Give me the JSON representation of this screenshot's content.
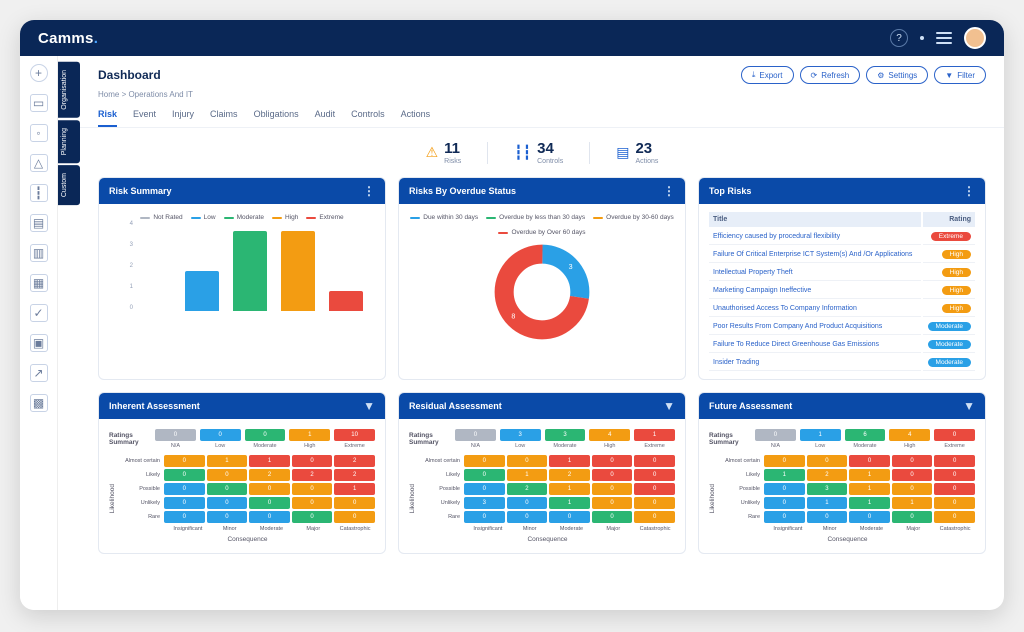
{
  "brand": "Camms",
  "header": {
    "title": "Dashboard",
    "breadcrumb": "Home > Operations And IT",
    "buttons": {
      "export": "Export",
      "refresh": "Refresh",
      "settings": "Settings",
      "filter": "Filter"
    }
  },
  "sideTabs": [
    "Organisation",
    "Planning",
    "Custom"
  ],
  "tabs": [
    "Risk",
    "Event",
    "Injury",
    "Claims",
    "Obligations",
    "Audit",
    "Controls",
    "Actions"
  ],
  "activeTab": 0,
  "kpis": [
    {
      "value": "11",
      "label": "Risks",
      "color": "#f39c12"
    },
    {
      "value": "34",
      "label": "Controls",
      "color": "#1a5fd0"
    },
    {
      "value": "23",
      "label": "Actions",
      "color": "#1a5fd0"
    }
  ],
  "colors": {
    "notRated": "#b0b7c3",
    "low": "#2aa0e6",
    "moderate": "#2bb673",
    "high": "#f39c12",
    "extreme": "#ea4a3e"
  },
  "riskSummary": {
    "title": "Risk Summary",
    "legend": [
      "Not Rated",
      "Low",
      "Moderate",
      "High",
      "Extreme"
    ]
  },
  "chart_data": [
    {
      "type": "bar",
      "id": "risk-summary",
      "categories": [
        "Not Rated",
        "Low",
        "Moderate",
        "High",
        "Extreme"
      ],
      "values": [
        0,
        2,
        4,
        4,
        1
      ],
      "colors": [
        "#b0b7c3",
        "#2aa0e6",
        "#2bb673",
        "#f39c12",
        "#ea4a3e"
      ],
      "ylim": [
        0,
        4
      ]
    },
    {
      "type": "pie",
      "id": "overdue-status",
      "series": [
        {
          "name": "Due within 30 days",
          "value": 3,
          "color": "#2aa0e6"
        },
        {
          "name": "Overdue by less than 30 days",
          "value": 0,
          "color": "#2bb673"
        },
        {
          "name": "Overdue by 30-60 days",
          "value": 0,
          "color": "#f39c12"
        },
        {
          "name": "Overdue by Over 60 days",
          "value": 8,
          "color": "#ea4a3e"
        }
      ]
    }
  ],
  "overdueCard": {
    "title": "Risks By Overdue Status",
    "legend": [
      "Due within 30 days",
      "Overdue by less than 30 days",
      "Overdue by 30-60 days",
      "Overdue by Over 60 days"
    ]
  },
  "topRisks": {
    "title": "Top Risks",
    "columns": [
      "Title",
      "Rating"
    ],
    "rows": [
      {
        "title": "Efficiency caused by procedural flexibility",
        "rating": "Extreme",
        "color": "#ea4a3e"
      },
      {
        "title": "Failure Of Critical Enterprise ICT System(s) And /Or Applications",
        "rating": "High",
        "color": "#f39c12"
      },
      {
        "title": "Intellectual Property Theft",
        "rating": "High",
        "color": "#f39c12"
      },
      {
        "title": "Marketing Campaign Ineffective",
        "rating": "High",
        "color": "#f39c12"
      },
      {
        "title": "Unauthorised Access To Company Information",
        "rating": "High",
        "color": "#f39c12"
      },
      {
        "title": "Poor Results From Company And Product Acquisitions",
        "rating": "Moderate",
        "color": "#2aa0e6"
      },
      {
        "title": "Failure To Reduce Direct Greenhouse Gas Emissions",
        "rating": "Moderate",
        "color": "#2aa0e6"
      },
      {
        "title": "Insider Trading",
        "rating": "Moderate",
        "color": "#2aa0e6"
      }
    ]
  },
  "assessments": [
    {
      "title": "Inherent Assessment",
      "summary": [
        {
          "v": "0",
          "c": "#b0b7c3"
        },
        {
          "v": "0",
          "c": "#2aa0e6"
        },
        {
          "v": "0",
          "c": "#2bb673"
        },
        {
          "v": "1",
          "c": "#f39c12"
        },
        {
          "v": "10",
          "c": "#ea4a3e"
        }
      ],
      "summaryLabels": [
        "N/A",
        "Low",
        "Moderate",
        "High",
        "Extreme"
      ],
      "yLabels": [
        "Almost certain",
        "Likely",
        "Possible",
        "Unlikely",
        "Rare"
      ],
      "xLabels": [
        "Insignificant",
        "Minor",
        "Moderate",
        "Major",
        "Catastrophic"
      ],
      "axisX": "Consequence",
      "axisY": "Likelihood",
      "cells": [
        [
          "0:#f39c12",
          "1:#f39c12",
          "1:#ea4a3e",
          "0:#ea4a3e",
          "2:#ea4a3e"
        ],
        [
          "0:#2bb673",
          "0:#f39c12",
          "2:#f39c12",
          "2:#ea4a3e",
          "2:#ea4a3e"
        ],
        [
          "0:#2aa0e6",
          "0:#2bb673",
          "0:#f39c12",
          "0:#f39c12",
          "1:#ea4a3e"
        ],
        [
          "0:#2aa0e6",
          "0:#2aa0e6",
          "0:#2bb673",
          "0:#f39c12",
          "0:#f39c12"
        ],
        [
          "0:#2aa0e6",
          "0:#2aa0e6",
          "0:#2aa0e6",
          "0:#2bb673",
          "0:#f39c12"
        ]
      ]
    },
    {
      "title": "Residual Assessment",
      "summary": [
        {
          "v": "0",
          "c": "#b0b7c3"
        },
        {
          "v": "3",
          "c": "#2aa0e6"
        },
        {
          "v": "3",
          "c": "#2bb673"
        },
        {
          "v": "4",
          "c": "#f39c12"
        },
        {
          "v": "1",
          "c": "#ea4a3e"
        }
      ],
      "summaryLabels": [
        "N/A",
        "Low",
        "Moderate",
        "High",
        "Extreme"
      ],
      "yLabels": [
        "Almost certain",
        "Likely",
        "Possible",
        "Unlikely",
        "Rare"
      ],
      "xLabels": [
        "Insignificant",
        "Minor",
        "Moderate",
        "Major",
        "Catastrophic"
      ],
      "axisX": "Consequence",
      "axisY": "Likelihood",
      "cells": [
        [
          "0:#f39c12",
          "0:#f39c12",
          "1:#ea4a3e",
          "0:#ea4a3e",
          "0:#ea4a3e"
        ],
        [
          "0:#2bb673",
          "1:#f39c12",
          "2:#f39c12",
          "0:#ea4a3e",
          "0:#ea4a3e"
        ],
        [
          "0:#2aa0e6",
          "2:#2bb673",
          "1:#f39c12",
          "0:#f39c12",
          "0:#ea4a3e"
        ],
        [
          "3:#2aa0e6",
          "0:#2aa0e6",
          "1:#2bb673",
          "0:#f39c12",
          "0:#f39c12"
        ],
        [
          "0:#2aa0e6",
          "0:#2aa0e6",
          "0:#2aa0e6",
          "0:#2bb673",
          "0:#f39c12"
        ]
      ]
    },
    {
      "title": "Future Assessment",
      "summary": [
        {
          "v": "0",
          "c": "#b0b7c3"
        },
        {
          "v": "1",
          "c": "#2aa0e6"
        },
        {
          "v": "6",
          "c": "#2bb673"
        },
        {
          "v": "4",
          "c": "#f39c12"
        },
        {
          "v": "0",
          "c": "#ea4a3e"
        }
      ],
      "summaryLabels": [
        "N/A",
        "Low",
        "Moderate",
        "High",
        "Extreme"
      ],
      "yLabels": [
        "Almost certain",
        "Likely",
        "Possible",
        "Unlikely",
        "Rare"
      ],
      "xLabels": [
        "Insignificant",
        "Minor",
        "Moderate",
        "Major",
        "Catastrophic"
      ],
      "axisX": "Consequence",
      "axisY": "Likelihood",
      "cells": [
        [
          "0:#f39c12",
          "0:#f39c12",
          "0:#ea4a3e",
          "0:#ea4a3e",
          "0:#ea4a3e"
        ],
        [
          "1:#2bb673",
          "2:#f39c12",
          "1:#f39c12",
          "0:#ea4a3e",
          "0:#ea4a3e"
        ],
        [
          "0:#2aa0e6",
          "3:#2bb673",
          "1:#f39c12",
          "0:#f39c12",
          "0:#ea4a3e"
        ],
        [
          "0:#2aa0e6",
          "1:#2aa0e6",
          "1:#2bb673",
          "1:#f39c12",
          "0:#f39c12"
        ],
        [
          "0:#2aa0e6",
          "0:#2aa0e6",
          "0:#2aa0e6",
          "0:#2bb673",
          "0:#f39c12"
        ]
      ]
    }
  ],
  "ratingsLabel": "Ratings Summary"
}
